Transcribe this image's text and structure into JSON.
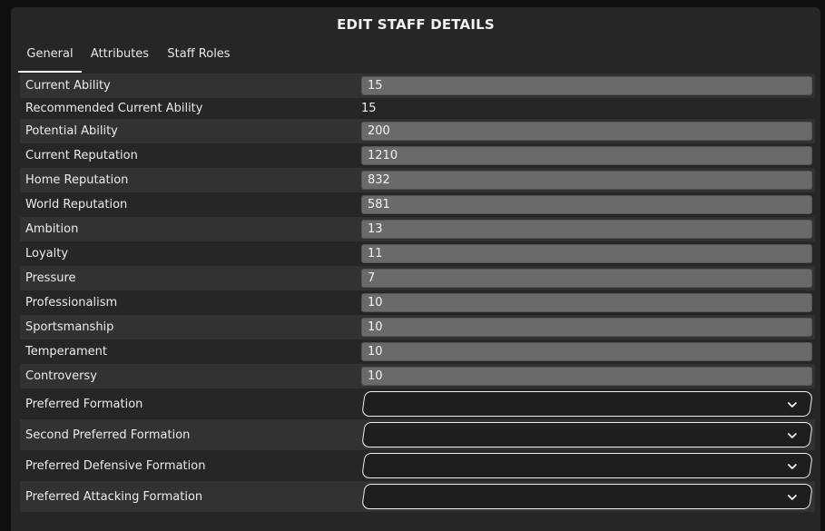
{
  "dialog": {
    "title": "EDIT STAFF DETAILS"
  },
  "tabs": [
    {
      "label": "General",
      "active": true
    },
    {
      "label": "Attributes",
      "active": false
    },
    {
      "label": "Staff Roles",
      "active": false
    }
  ],
  "fields": {
    "current_ability": {
      "label": "Current Ability",
      "value": "15"
    },
    "recommended_current_ability": {
      "label": "Recommended Current Ability",
      "value": "15"
    },
    "potential_ability": {
      "label": "Potential Ability",
      "value": "200"
    },
    "current_reputation": {
      "label": "Current Reputation",
      "value": "1210"
    },
    "home_reputation": {
      "label": "Home Reputation",
      "value": "832"
    },
    "world_reputation": {
      "label": "World Reputation",
      "value": "581"
    },
    "ambition": {
      "label": "Ambition",
      "value": "13"
    },
    "loyalty": {
      "label": "Loyalty",
      "value": "11"
    },
    "pressure": {
      "label": "Pressure",
      "value": "7"
    },
    "professionalism": {
      "label": "Professionalism",
      "value": "10"
    },
    "sportsmanship": {
      "label": "Sportsmanship",
      "value": "10"
    },
    "temperament": {
      "label": "Temperament",
      "value": "10"
    },
    "controversy": {
      "label": "Controversy",
      "value": "10"
    }
  },
  "dropdowns": {
    "preferred_formation": {
      "label": "Preferred Formation",
      "selected": ""
    },
    "second_preferred_formation": {
      "label": "Second Preferred Formation",
      "selected": ""
    },
    "preferred_defensive_formation": {
      "label": "Preferred Defensive Formation",
      "selected": ""
    },
    "preferred_attacking_formation": {
      "label": "Preferred Attacking Formation",
      "selected": ""
    }
  },
  "icons": {
    "dropdown_arrow": "chevron-down-icon"
  },
  "colors": {
    "dialog_bg": "#262626",
    "row_alt_bg": "#323232",
    "field_bg": "#6a6a6a",
    "text": "#ececec",
    "accent_underline": "#ffffff"
  }
}
